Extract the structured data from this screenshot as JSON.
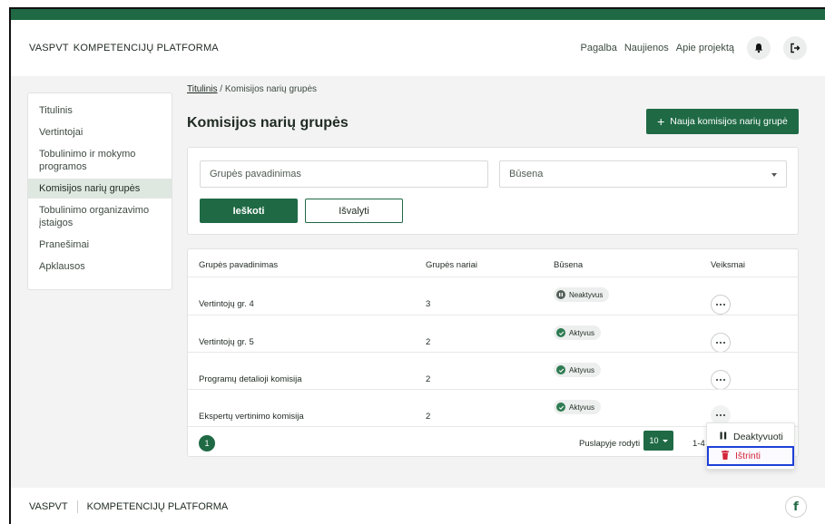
{
  "header": {
    "brand_short": "VASPVT",
    "brand_long": "KOMPETENCIJŲ PLATFORMA",
    "nav": [
      "Pagalba",
      "Naujienos",
      "Apie projektą"
    ],
    "bell_icon": "bell-icon",
    "logout_icon": "logout-icon"
  },
  "sidebar": {
    "items": [
      {
        "label": "Titulinis",
        "active": false
      },
      {
        "label": "Vertintojai",
        "active": false
      },
      {
        "label": "Tobulinimo ir mokymo programos",
        "active": false
      },
      {
        "label": "Komisijos narių grupės",
        "active": true
      },
      {
        "label": "Tobulinimo organizavimo įstaigos",
        "active": false
      },
      {
        "label": "Pranešimai",
        "active": false
      },
      {
        "label": "Apklausos",
        "active": false
      }
    ]
  },
  "breadcrumb": {
    "home": "Titulinis",
    "separator": " / ",
    "current": "Komisijos narių grupės"
  },
  "page": {
    "title": "Komisijos narių grupės",
    "add_button": "Nauja komisijos narių grupė"
  },
  "filters": {
    "name_placeholder": "Grupės pavadinimas",
    "status_placeholder": "Būsena",
    "search_button": "Ieškoti",
    "clear_button": "Išvalyti"
  },
  "table": {
    "headers": [
      "Grupės pavadinimas",
      "Grupės nariai",
      "Būsena",
      "Veiksmai"
    ],
    "rows": [
      {
        "name": "Vertintojų gr. 4",
        "members": "3",
        "status": "Neaktyvus",
        "status_type": "inactive"
      },
      {
        "name": "Vertintojų gr. 5",
        "members": "2",
        "status": "Aktyvus",
        "status_type": "active"
      },
      {
        "name": "Programų detalioji komisija",
        "members": "2",
        "status": "Aktyvus",
        "status_type": "active"
      },
      {
        "name": "Ekspertų vertinimo komisija",
        "members": "2",
        "status": "Aktyvus",
        "status_type": "active"
      }
    ]
  },
  "pagination": {
    "current_page": "1",
    "per_page_label": "Puslapyje rodyti",
    "per_page": "10",
    "range": "1-4"
  },
  "action_menu": {
    "deactivate": "Deaktyvuoti",
    "delete": "Ištrinti"
  },
  "footer": {
    "brand_short": "VASPVT",
    "brand_long": "KOMPETENCIJŲ PLATFORMA",
    "social_icon": "facebook-icon",
    "social_glyph": "f"
  },
  "colors": {
    "primary": "#1f6a45",
    "danger": "#d3263b",
    "highlight": "#1f3fd8"
  }
}
